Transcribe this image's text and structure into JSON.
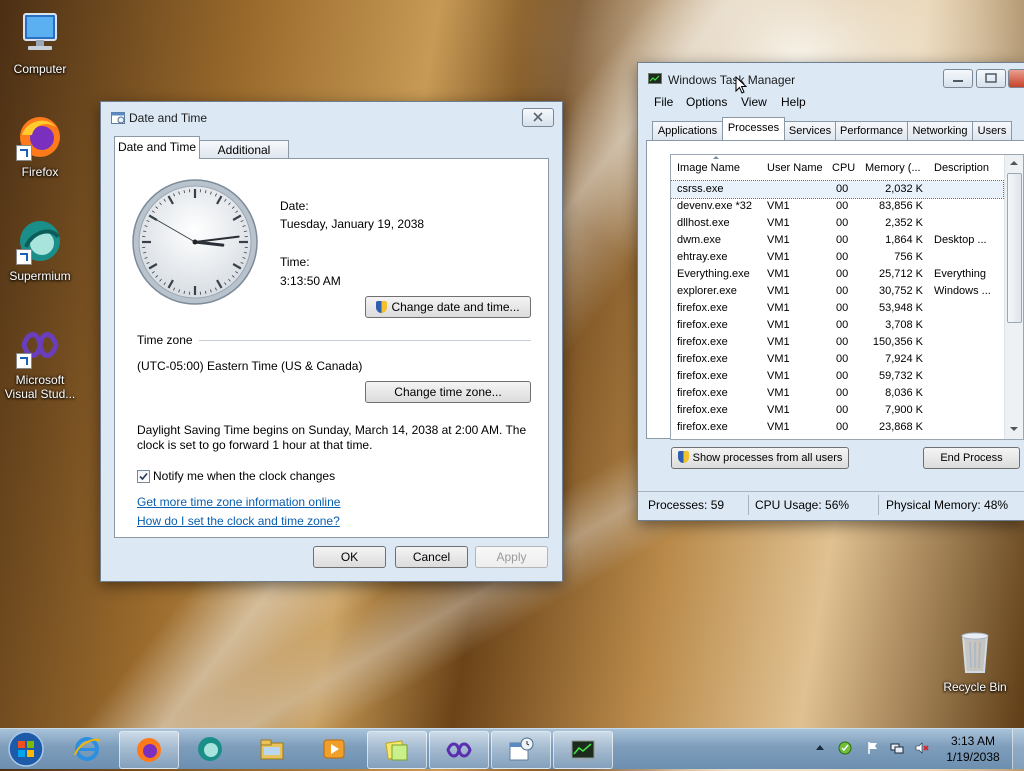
{
  "desktop": {
    "icons": [
      {
        "label": "Computer",
        "icon": "computer-icon"
      },
      {
        "label": "Firefox",
        "icon": "firefox-icon"
      },
      {
        "label": "Supermium",
        "icon": "supermium-icon"
      },
      {
        "label": "Microsoft Visual Stud...",
        "icon": "visual-studio-icon"
      },
      {
        "label": "Recycle Bin",
        "icon": "recycle-bin-icon"
      }
    ]
  },
  "datetime": {
    "title": "Date and Time",
    "tabs": [
      "Date and Time",
      "Additional Clocks"
    ],
    "date_label": "Date:",
    "date_value": "Tuesday, January 19, 2038",
    "time_label": "Time:",
    "time_value": "3:13:50 AM",
    "clock": {
      "hour": 3,
      "minute": 13,
      "second": 50
    },
    "change_date_button": "Change date and time...",
    "timezone_heading": "Time zone",
    "timezone_value": "(UTC-05:00) Eastern Time (US & Canada)",
    "change_timezone_button": "Change time zone...",
    "dst_text_line1": "Daylight Saving Time begins on Sunday, March 14, 2038 at 2:00 AM. The",
    "dst_text_line2": "clock is set to go forward 1 hour at that time.",
    "notify_label": "Notify me when the clock changes",
    "notify_checked": true,
    "link1": "Get more time zone information online",
    "link2": "How do I set the clock and time zone?",
    "ok": "OK",
    "cancel": "Cancel",
    "apply": "Apply"
  },
  "taskmgr": {
    "title": "Windows Task Manager",
    "menu": [
      "File",
      "Options",
      "View",
      "Help"
    ],
    "tabs": [
      "Applications",
      "Processes",
      "Services",
      "Performance",
      "Networking",
      "Users"
    ],
    "active_tab": "Processes",
    "columns": [
      "Image Name",
      "User Name",
      "CPU",
      "Memory (...",
      "Description"
    ],
    "rows": [
      {
        "name": "csrss.exe",
        "user": "",
        "cpu": "00",
        "mem": "2,032 K",
        "desc": ""
      },
      {
        "name": "devenv.exe *32",
        "user": "VM1",
        "cpu": "00",
        "mem": "83,856 K",
        "desc": ""
      },
      {
        "name": "dllhost.exe",
        "user": "VM1",
        "cpu": "00",
        "mem": "2,352 K",
        "desc": ""
      },
      {
        "name": "dwm.exe",
        "user": "VM1",
        "cpu": "00",
        "mem": "1,864 K",
        "desc": "Desktop ..."
      },
      {
        "name": "ehtray.exe",
        "user": "VM1",
        "cpu": "00",
        "mem": "756 K",
        "desc": ""
      },
      {
        "name": "Everything.exe",
        "user": "VM1",
        "cpu": "00",
        "mem": "25,712 K",
        "desc": "Everything"
      },
      {
        "name": "explorer.exe",
        "user": "VM1",
        "cpu": "00",
        "mem": "30,752 K",
        "desc": "Windows ..."
      },
      {
        "name": "firefox.exe",
        "user": "VM1",
        "cpu": "00",
        "mem": "53,948 K",
        "desc": ""
      },
      {
        "name": "firefox.exe",
        "user": "VM1",
        "cpu": "00",
        "mem": "3,708 K",
        "desc": ""
      },
      {
        "name": "firefox.exe",
        "user": "VM1",
        "cpu": "00",
        "mem": "150,356 K",
        "desc": ""
      },
      {
        "name": "firefox.exe",
        "user": "VM1",
        "cpu": "00",
        "mem": "7,924 K",
        "desc": ""
      },
      {
        "name": "firefox.exe",
        "user": "VM1",
        "cpu": "00",
        "mem": "59,732 K",
        "desc": ""
      },
      {
        "name": "firefox.exe",
        "user": "VM1",
        "cpu": "00",
        "mem": "8,036 K",
        "desc": ""
      },
      {
        "name": "firefox.exe",
        "user": "VM1",
        "cpu": "00",
        "mem": "7,900 K",
        "desc": ""
      },
      {
        "name": "firefox.exe",
        "user": "VM1",
        "cpu": "00",
        "mem": "23,868 K",
        "desc": ""
      }
    ],
    "show_all_button": "Show processes from all users",
    "end_process_button": "End Process",
    "status_processes": "Processes: 59",
    "status_cpu": "CPU Usage: 56%",
    "status_memory": "Physical Memory: 48%"
  },
  "taskbar": {
    "items": [
      "start-orb-icon",
      "internet-explorer-icon",
      "firefox-icon",
      "supermium-icon",
      "file-explorer-icon",
      "media-player-icon",
      "sticky-notes-icon",
      "visual-studio-icon",
      "date-time-control-panel-icon",
      "task-manager-icon"
    ],
    "clock_time": "3:13 AM",
    "clock_date": "1/19/2038"
  }
}
